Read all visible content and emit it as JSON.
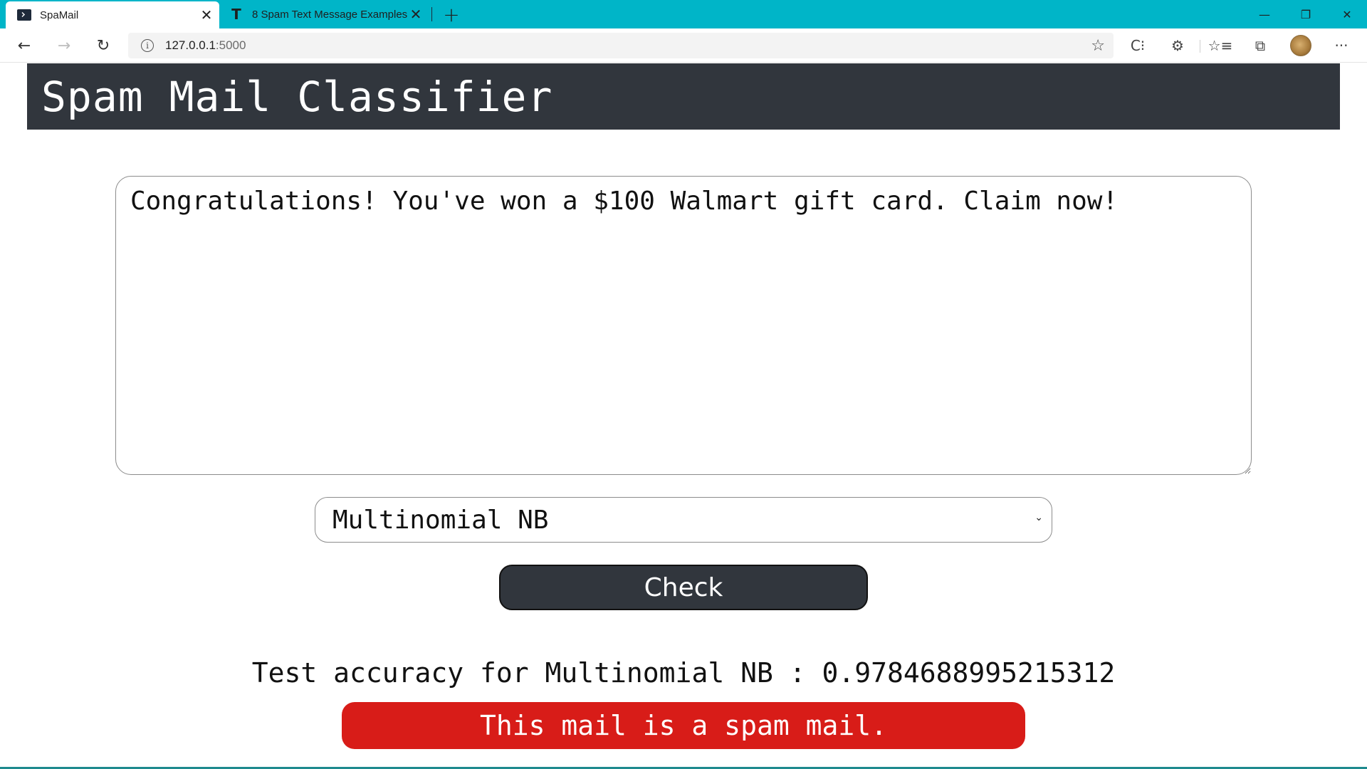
{
  "browser": {
    "tabs": [
      {
        "title": "SpaMail",
        "favicon": "terminal-icon",
        "active": true
      },
      {
        "title": "8 Spam Text Message Examples",
        "favicon": "t-letter-icon",
        "active": false
      }
    ],
    "close_glyph": "✕",
    "new_tab_glyph": "+",
    "window_controls": {
      "minimize": "—",
      "restore": "❐",
      "close": "✕"
    },
    "address": {
      "host": "127.0.0.1",
      "port": ":5000",
      "info_glyph": "i"
    },
    "nav": {
      "back": "←",
      "forward": "→",
      "reload": "↻"
    },
    "toolbar_icons": {
      "favorite_add": "☆",
      "extension_c": "C⁝",
      "extensions": "⚙",
      "favorites": "☆≡",
      "collections": "⧉",
      "more": "···"
    },
    "colors": {
      "tab_strip": "#00b5c8"
    }
  },
  "app": {
    "title": "Spam Mail Classifier",
    "mail_text": "Congratulations! You've won a $100 Walmart gift card. Claim now!",
    "model_selected": "Multinomial NB",
    "check_label": "Check",
    "accuracy_text": "Test accuracy for Multinomial NB : 0.9784688995215312",
    "result_text": "This mail is a spam mail.",
    "colors": {
      "header_bg": "#31363d",
      "result_bg": "#d81c18"
    }
  }
}
